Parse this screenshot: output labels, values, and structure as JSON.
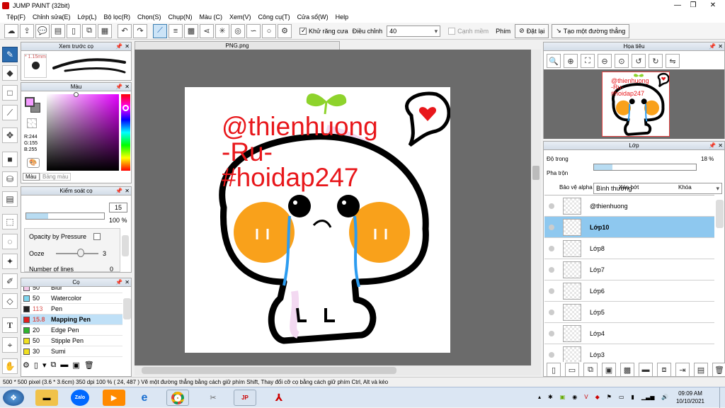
{
  "window": {
    "title": "JUMP PAINT (32bit)"
  },
  "menu": [
    "Tệp(F)",
    "Chỉnh sửa(E)",
    "Lớp(L)",
    "Bộ lọc(R)",
    "Chọn(S)",
    "Chụp(N)",
    "Màu (C)",
    "Xem(V)",
    "Công cụ(T)",
    "Cửa sổ(W)",
    "Help"
  ],
  "toolbar": {
    "antialias_label": "Khử răng cưa",
    "adjust_label": "Điều chỉnh",
    "adjust_value": "40",
    "edge_label": "Cạnh mềm",
    "key_label": "Phím",
    "reset_label": "Đặt lại",
    "straight_line_label": "Tạo một đường thẳng"
  },
  "brush_preview": {
    "title": "Xem trước cọ",
    "size": "1.15mm"
  },
  "color_panel": {
    "title": "Màu",
    "r": "R:244",
    "g": "G:155",
    "b": "B:255",
    "tab1": "Màu",
    "tab2": "Bảng màu"
  },
  "brush_control": {
    "title": "Kiểm soát cọ",
    "size_value": "15",
    "size_fraction": 0.28,
    "opacity_value": "100 %",
    "opacity_fraction": 1.0,
    "opacity_pressure_label": "Opacity by Pressure",
    "ooze_label": "Ooze",
    "ooze_value": "3",
    "number_label": "Number of lines",
    "number_value": "0"
  },
  "brushes": {
    "title": "Cọ",
    "items": [
      {
        "size": "50",
        "name": "Blur",
        "color": "#f3c9e8",
        "selected": false
      },
      {
        "size": "50",
        "name": "Watercolor",
        "color": "#7fd6f0",
        "selected": false
      },
      {
        "size": "113",
        "name": "Pen",
        "color": "#222222",
        "selected": false,
        "size_color": "#d9534f"
      },
      {
        "size": "15.8",
        "name": "Mapping Pen",
        "color": "#e02020",
        "selected": true,
        "size_color": "#d9534f"
      },
      {
        "size": "20",
        "name": "Edge Pen",
        "color": "#2fb52f",
        "selected": false
      },
      {
        "size": "50",
        "name": "Stipple Pen",
        "color": "#f0e020",
        "selected": false
      },
      {
        "size": "30",
        "name": "Sumi",
        "color": "#f0e020",
        "selected": false
      }
    ]
  },
  "document": {
    "tab": "PNG.png"
  },
  "artwork": {
    "line1": "@thienhuong",
    "line2": "-Ru-",
    "line3": "#hoidap247",
    "text_color": "#e8171b"
  },
  "navigator": {
    "title": "Họa tiêu"
  },
  "layers_panel": {
    "title": "Lớp",
    "opacity_label": "Độ trong",
    "opacity_value": "18 %",
    "opacity_fraction": 0.18,
    "blend_label": "Pha trộn",
    "blend_value": "Bình thường",
    "protect_alpha": "Bảo vệ alpha",
    "clip": "Xén bớt",
    "lock": "Khóa",
    "layers": [
      {
        "name": "@thienhuong",
        "selected": false
      },
      {
        "name": "Lớp10",
        "selected": true
      },
      {
        "name": "Lớp8",
        "selected": false
      },
      {
        "name": "Lớp7",
        "selected": false
      },
      {
        "name": "Lớp6",
        "selected": false
      },
      {
        "name": "Lớp5",
        "selected": false
      },
      {
        "name": "Lớp4",
        "selected": false
      },
      {
        "name": "Lớp3",
        "selected": false
      }
    ]
  },
  "status": {
    "text": "500 * 500 pixel   (3.6 * 3.6cm)   350 dpi   100 %   ( 24, 487 )   Vẽ một đường thẳng bằng cách giữ phím Shift, Thay đổi cỡ cọ bằng cách giữ phím Ctrl, Alt và kéo"
  },
  "taskbar": {
    "time": "09:09 AM",
    "date": "10/10/2021",
    "zalo": "Zalo"
  }
}
